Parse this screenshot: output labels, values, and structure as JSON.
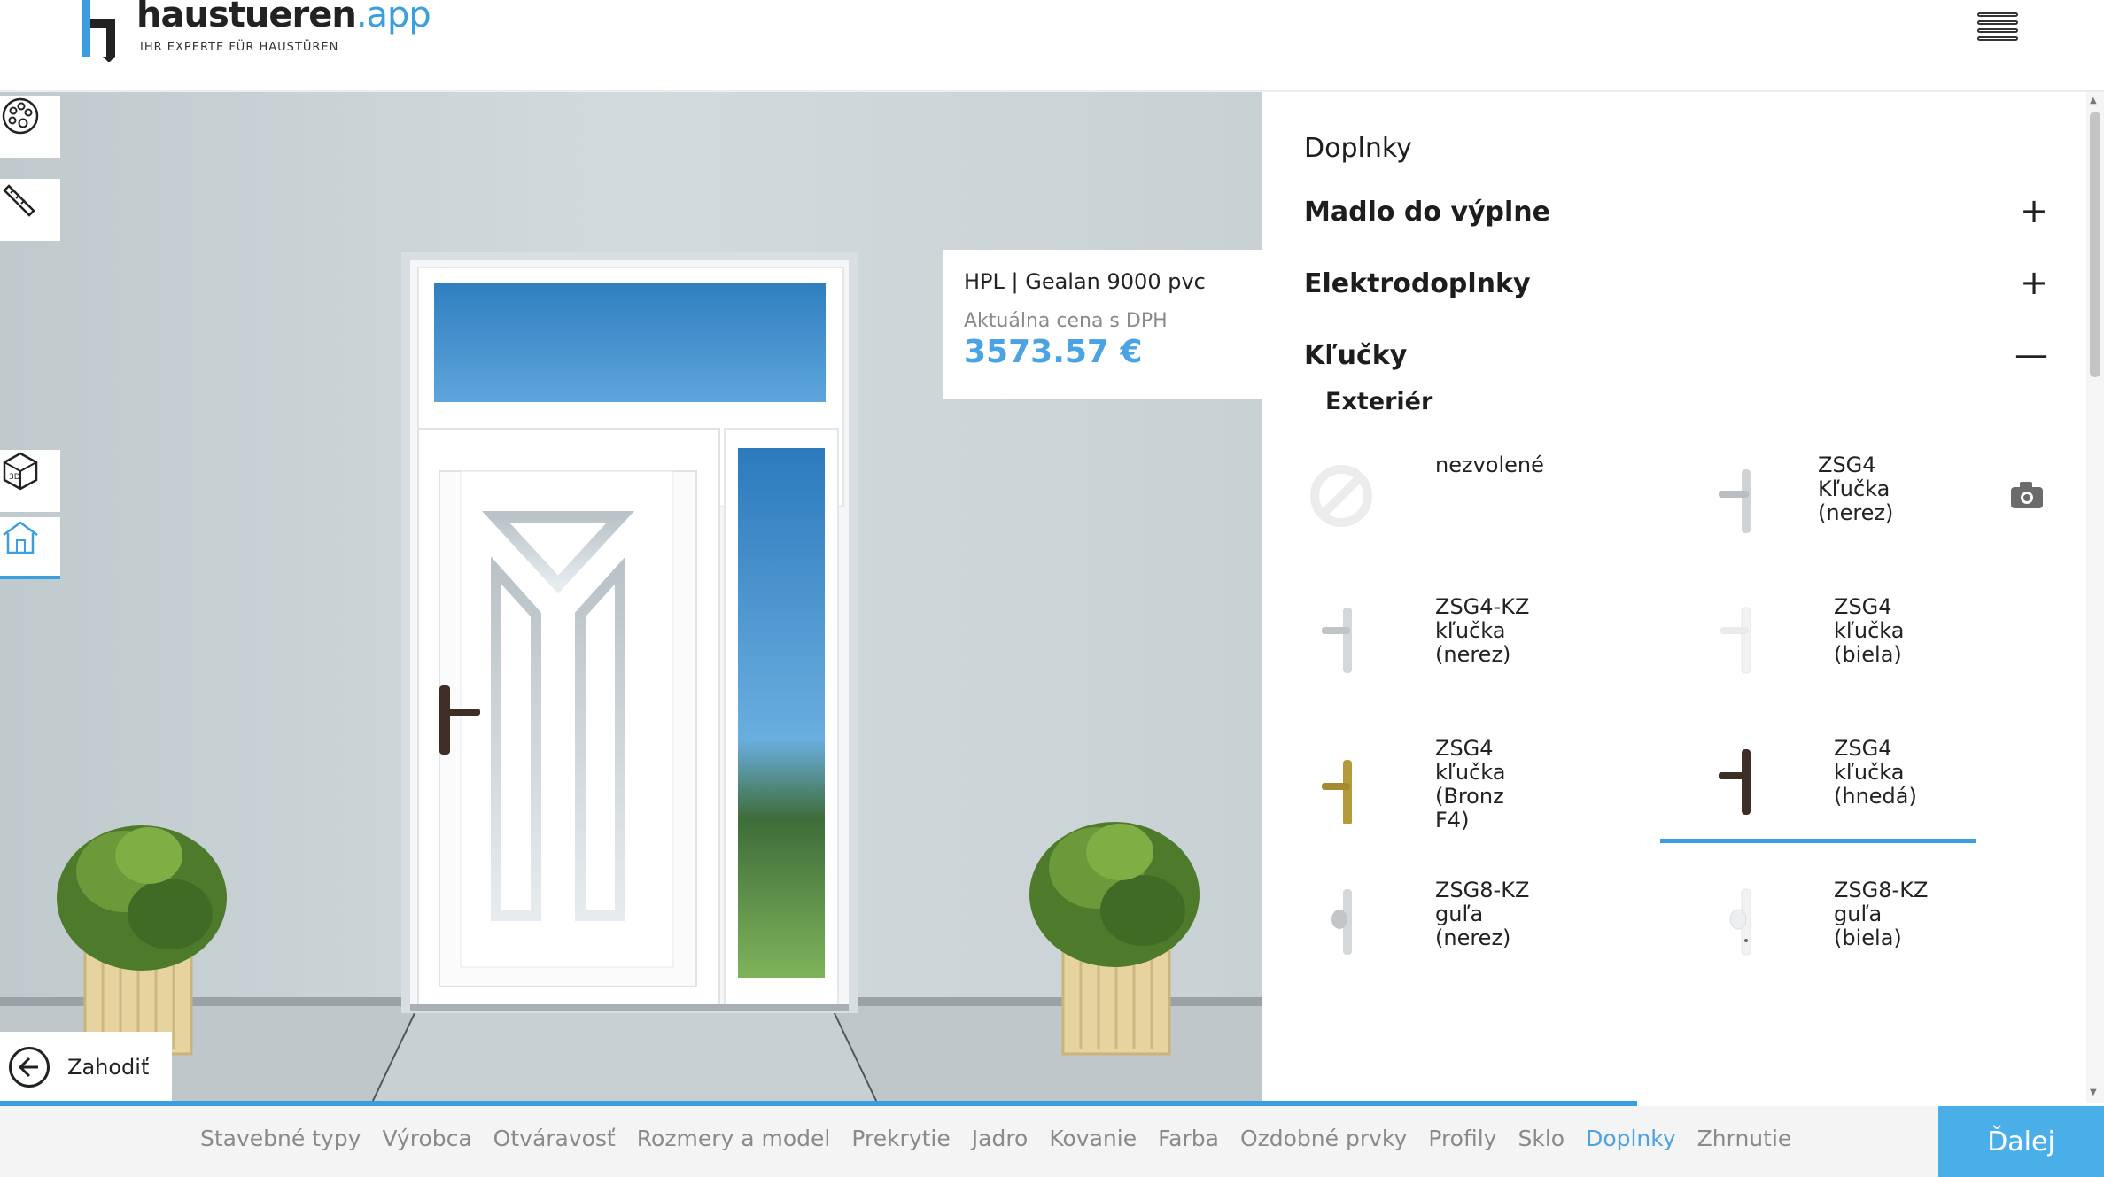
{
  "header": {
    "logo_name": "haustueren",
    "logo_app": ".app",
    "logo_tagline": "IHR EXPERTE FÜR HAUSTÜREN",
    "menu_icon": "hamburger-menu-icon"
  },
  "tools": [
    {
      "icon": "palette-icon"
    },
    {
      "icon": "ruler-icon"
    },
    {
      "icon": "cube-3d-icon"
    },
    {
      "icon": "house-icon"
    }
  ],
  "price_card": {
    "product": "HPL | Gealan 9000 pvc",
    "price_label": "Aktuálna cena s DPH",
    "price_value": "3573.57 €"
  },
  "discard": {
    "label": "Zahodiť",
    "icon": "arrow-left-circle-icon"
  },
  "panel": {
    "title": "Doplnky",
    "sections": [
      {
        "label": "Madlo do výplne",
        "sign": "+"
      },
      {
        "label": "Elektrodoplnky",
        "sign": "+"
      },
      {
        "label": "Kľučky",
        "sign": "—"
      }
    ],
    "subhead": "Exteriér",
    "options": [
      {
        "label": "nezvolené",
        "kind": "none"
      },
      {
        "label": "ZSG4\nKľučka\n(nerez)",
        "kind": "steel",
        "has_camera": true
      },
      {
        "label": "ZSG4-KZ\nkľučka\n(nerez)",
        "kind": "steel"
      },
      {
        "label": "ZSG4\nkľučka\n(biela)",
        "kind": "white"
      },
      {
        "label": "ZSG4\nkľučka\n(Bronz\nF4)",
        "kind": "bronze"
      },
      {
        "label": "ZSG4\nkľučka\n(hnedá)",
        "kind": "brown",
        "selected": true
      },
      {
        "label": "ZSG8-KZ\nguľa\n(nerez)",
        "kind": "steel-knob"
      },
      {
        "label": "ZSG8-KZ\nguľa\n(biela)",
        "kind": "white-knob"
      }
    ]
  },
  "footer": {
    "progress_fraction": 0.778,
    "steps": [
      "Stavebné typy",
      "Výrobca",
      "Otváravosť",
      "Rozmery a model",
      "Prekrytie",
      "Jadro",
      "Kovanie",
      "Farba",
      "Ozdobné prvky",
      "Profily",
      "Sklo",
      "Doplnky",
      "Zhrnutie"
    ],
    "active_step": 11,
    "next_label": "Ďalej"
  },
  "colors": {
    "accent": "#4aa3e2",
    "button": "#4aaee8",
    "handle_brown": "#3e2f26",
    "handle_bronze": "#b59a3b"
  }
}
